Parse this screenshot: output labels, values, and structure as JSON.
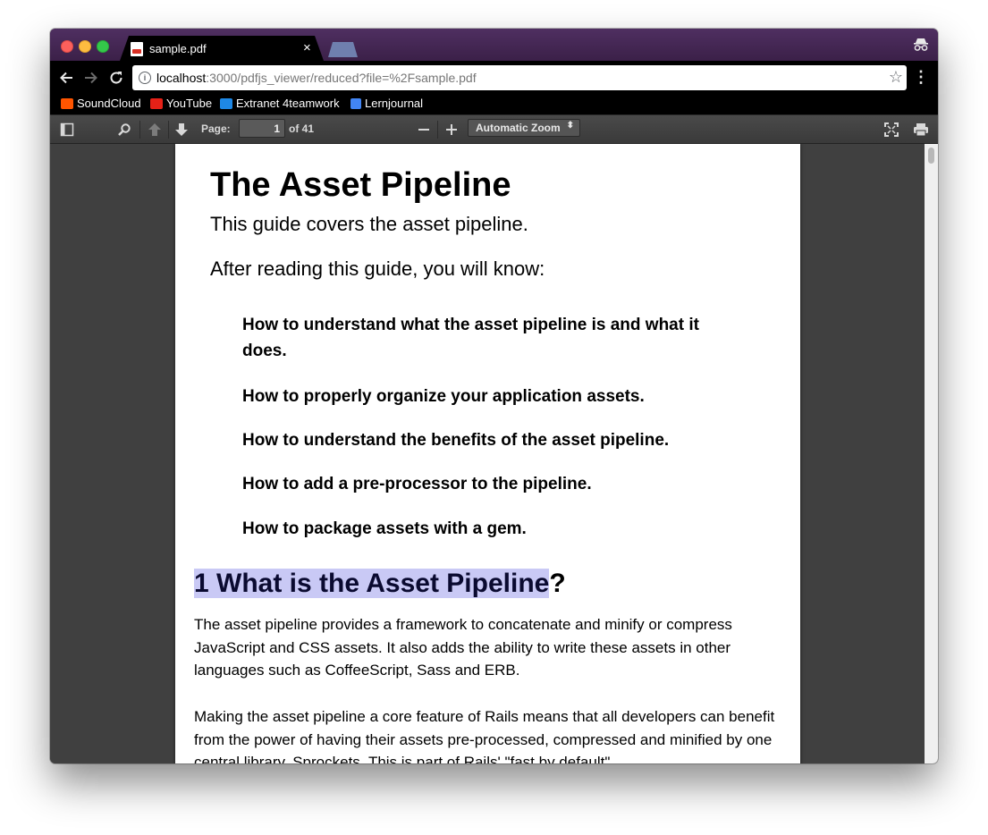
{
  "browser": {
    "tab_title": "sample.pdf",
    "tab_close": "×",
    "url_host": "localhost",
    "url_rest": ":3000/pdfjs_viewer/reduced?file=%2Fsample.pdf",
    "icons": {
      "back": "back-arrow-icon",
      "forward": "forward-arrow-icon",
      "reload": "reload-icon",
      "info": "info-icon",
      "star": "star-icon",
      "menu": "kebab-menu-icon",
      "incognito": "incognito-icon"
    }
  },
  "bookmarks": [
    {
      "label": "SoundCloud",
      "color": "#ff5500"
    },
    {
      "label": "YouTube",
      "color": "#e62117"
    },
    {
      "label": "Extranet 4teamwork",
      "color": "#1e88e5"
    },
    {
      "label": "Lernjournal",
      "color": "#4285f4"
    }
  ],
  "pdf_toolbar": {
    "page_label": "Page:",
    "page_value": "1",
    "page_count": "of 41",
    "zoom_label": "Automatic Zoom",
    "icons": {
      "sidebar": "sidebar-toggle-icon",
      "find": "search-icon",
      "prev": "previous-page-icon",
      "next": "next-page-icon",
      "zoom_out": "zoom-out-icon",
      "zoom_in": "zoom-in-icon",
      "presentation": "presentation-mode-icon",
      "print": "print-icon"
    }
  },
  "document": {
    "title": "The Asset Pipeline",
    "subtitle": "This guide covers the asset pipeline.",
    "intro": "After reading this guide, you will know:",
    "bullets": [
      "How to understand what the asset pipeline is and what it does.",
      "How to properly organize your application assets.",
      "How to understand the benefits of the asset pipeline.",
      "How to add a pre-processor to the pipeline.",
      "How to package assets with a gem."
    ],
    "section_heading_highlighted": "1 What is the Asset Pipeline",
    "section_heading_rest": "?",
    "paragraph1": "The asset pipeline provides a framework to concatenate and minify or compress JavaScript and CSS assets. It also adds the ability to write these assets in other languages such as CoffeeScript, Sass and ERB.",
    "paragraph2": "Making the asset pipeline a core feature of Rails means that all developers can benefit from the power of having their assets pre-processed, compressed and minified by one central library, Sprockets. This is part of Rails' \"fast by default\""
  },
  "colors": {
    "titlebar": "#4f2f61",
    "highlight": "#c9c9f5",
    "viewer_bg": "#404040"
  }
}
